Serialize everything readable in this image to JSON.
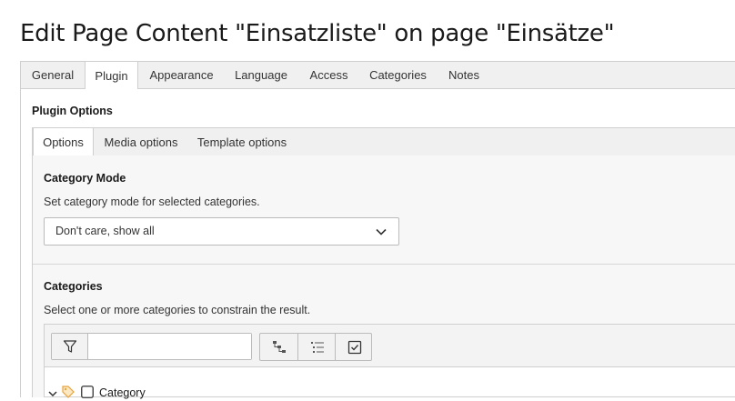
{
  "page": {
    "title": "Edit Page Content \"Einsatzliste\" on page \"Einsätze\""
  },
  "main_tabs": [
    {
      "label": "General",
      "active": false
    },
    {
      "label": "Plugin",
      "active": true
    },
    {
      "label": "Appearance",
      "active": false
    },
    {
      "label": "Language",
      "active": false
    },
    {
      "label": "Access",
      "active": false
    },
    {
      "label": "Categories",
      "active": false
    },
    {
      "label": "Notes",
      "active": false
    }
  ],
  "plugin_options": {
    "heading": "Plugin Options",
    "sub_tabs": [
      {
        "label": "Options",
        "active": true
      },
      {
        "label": "Media options",
        "active": false
      },
      {
        "label": "Template options",
        "active": false
      }
    ]
  },
  "category_mode": {
    "label": "Category Mode",
    "description": "Set category mode for selected categories.",
    "selected": "Don't care, show all"
  },
  "categories": {
    "label": "Categories",
    "description": "Select one or more categories to constrain the result.",
    "filter": {
      "value": "",
      "placeholder": ""
    },
    "toolbar_icons": [
      "filter-icon",
      "tree-collapse-icon",
      "list-expand-icon",
      "check-all-icon"
    ],
    "tree": [
      {
        "label": "Category",
        "expanded": true,
        "checked": false,
        "icon": "category-tag-icon"
      }
    ]
  },
  "colors": {
    "accent_tag": "#e8a33b",
    "border": "#cfcfcf",
    "tab_bg": "#f0f0f0"
  }
}
